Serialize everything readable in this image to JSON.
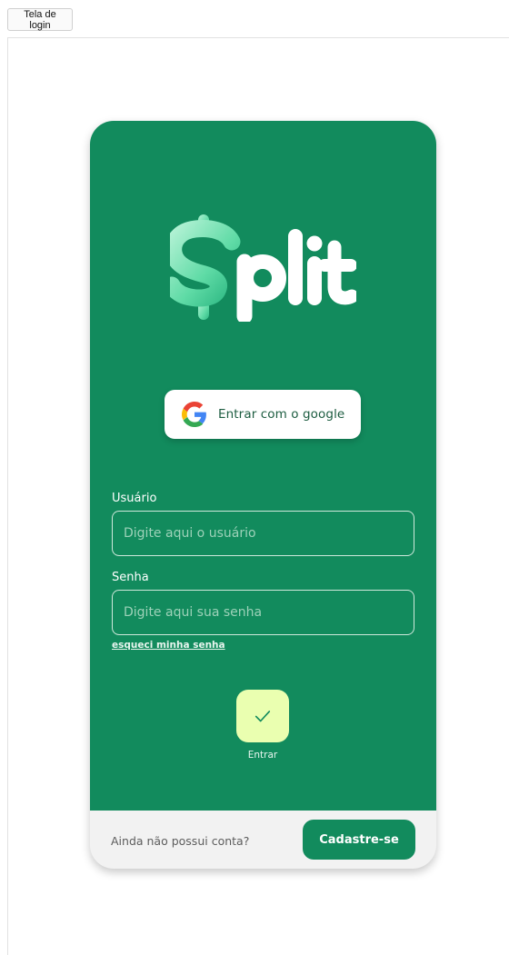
{
  "tab": {
    "label": "Tela de login"
  },
  "login": {
    "google_button_label": "Entrar com o google",
    "username": {
      "label": "Usuário",
      "placeholder": "Digite aqui o usuário",
      "value": ""
    },
    "password": {
      "label": "Senha",
      "placeholder": "Digite aqui sua senha",
      "value": ""
    },
    "forgot_link": "esqueci minha senha",
    "submit_label": "Entrar"
  },
  "footer": {
    "no_account_text": "Ainda não possui conta?",
    "signup_label": "Cadastre-se"
  },
  "icons": {
    "logo": "split-logo",
    "google": "google-icon",
    "submit": "check-icon"
  },
  "colors": {
    "brand_green": "#128b5d",
    "submit_bg": "#eaffb0",
    "footer_bg": "#f2f2f2"
  }
}
